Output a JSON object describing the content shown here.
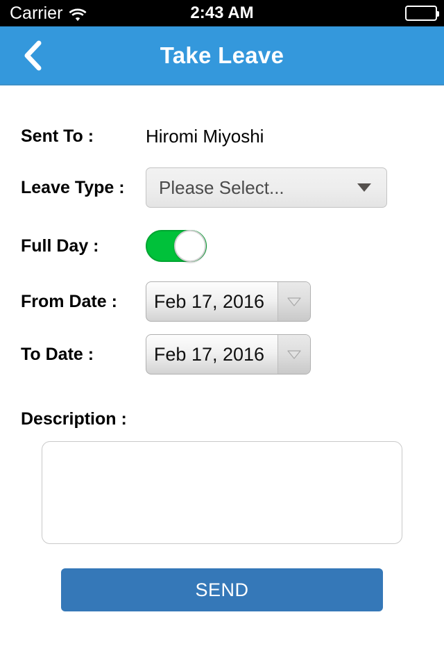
{
  "status_bar": {
    "carrier": "Carrier",
    "wifi_icon": "wifi-icon",
    "time": "2:43 AM",
    "battery_icon": "battery-icon"
  },
  "nav_bar": {
    "back_icon": "chevron-left-icon",
    "title": "Take Leave",
    "background_color": "#3498dc"
  },
  "form": {
    "sent_to": {
      "label": "Sent To :",
      "value": "Hiromi Miyoshi"
    },
    "leave_type": {
      "label": "Leave Type :",
      "selected": "Please Select...",
      "caret_icon": "caret-down-icon"
    },
    "full_day": {
      "label": "Full Day :",
      "state": "on",
      "on_color": "#00c13a"
    },
    "from_date": {
      "label": "From Date :",
      "value": "Feb 17, 2016",
      "arrow_icon": "triangle-down-icon"
    },
    "to_date": {
      "label": "To Date :",
      "value": "Feb 17, 2016",
      "arrow_icon": "triangle-down-icon"
    },
    "description": {
      "label": "Description :",
      "value": "",
      "placeholder": ""
    },
    "send": {
      "label": "SEND",
      "color": "#3578b8"
    }
  }
}
